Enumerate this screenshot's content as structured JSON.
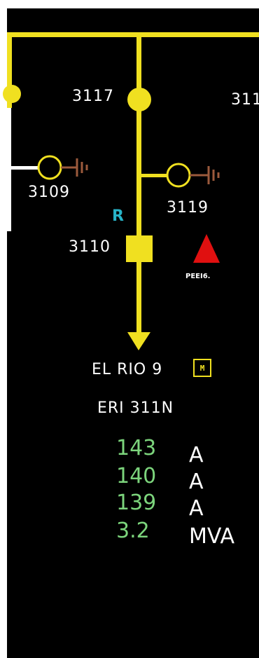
{
  "colors": {
    "background": "#000000",
    "bus": "#f0e020",
    "ground": "#9b5a3c",
    "alarm": "#e01010",
    "measurement_value": "#7cd47c",
    "label": "#ffffff",
    "breaker_mark": "#28b4c8"
  },
  "nodes": {
    "n3117": "3117",
    "n3109": "3109",
    "n3119": "3119",
    "n3110": "3110",
    "n311x": "311"
  },
  "breaker_mark": "R",
  "alarm_label": "PEEI6.",
  "feeder": {
    "name": "EL RIO 9",
    "code": "ERI 311N",
    "mode_icon": "M"
  },
  "measurements": [
    {
      "value": "143",
      "unit": "A"
    },
    {
      "value": "140",
      "unit": "A"
    },
    {
      "value": "139",
      "unit": "A"
    },
    {
      "value": "3.2",
      "unit": "MVA"
    }
  ]
}
